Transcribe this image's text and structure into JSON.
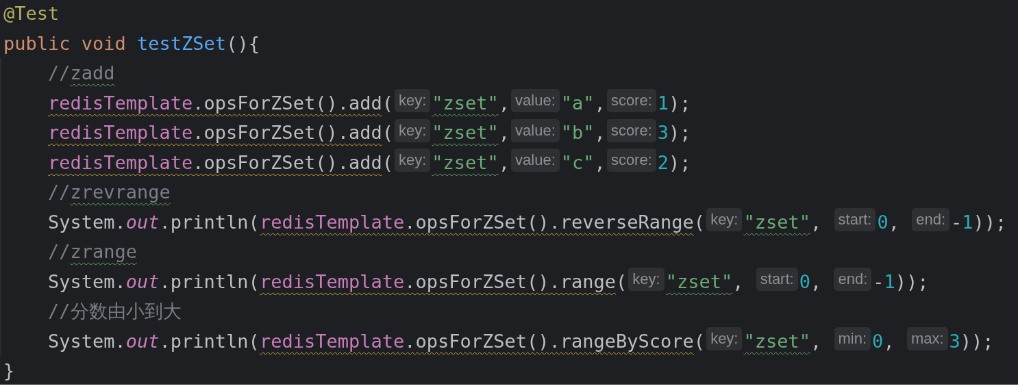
{
  "editor": {
    "lines": [
      {
        "indented": false,
        "tokens": [
          {
            "kind": "annotation",
            "text": "@Test",
            "warned": false,
            "misspelled": false
          }
        ]
      },
      {
        "indented": false,
        "tokens": [
          {
            "kind": "keyword",
            "text": "public void ",
            "warned": false,
            "misspelled": false
          },
          {
            "kind": "method",
            "text": "testZSet",
            "warned": false,
            "misspelled": false
          },
          {
            "kind": "plain",
            "text": "(){",
            "warned": false,
            "misspelled": false
          }
        ]
      },
      {
        "indented": true,
        "tokens": [
          {
            "kind": "comment",
            "text": "//",
            "warned": false,
            "misspelled": false
          },
          {
            "kind": "comment",
            "text": "zadd",
            "warned": false,
            "misspelled": true
          }
        ]
      },
      {
        "indented": true,
        "tokens": [
          {
            "kind": "field",
            "text": "redisTemplate",
            "warned": true,
            "misspelled": false
          },
          {
            "kind": "plain",
            "text": ".opsForZSet().add",
            "warned": true,
            "misspelled": false
          },
          {
            "kind": "plain",
            "text": "(",
            "warned": false,
            "misspelled": false
          },
          {
            "kind": "hint",
            "text": "key:",
            "warned": false,
            "misspelled": false
          },
          {
            "kind": "string",
            "text": "\"zset\"",
            "warned": false,
            "misspelled": true
          },
          {
            "kind": "plain",
            "text": ",",
            "warned": false,
            "misspelled": false
          },
          {
            "kind": "hint",
            "text": "value:",
            "warned": false,
            "misspelled": false
          },
          {
            "kind": "string",
            "text": "\"a\"",
            "warned": false,
            "misspelled": false
          },
          {
            "kind": "plain",
            "text": ",",
            "warned": false,
            "misspelled": false
          },
          {
            "kind": "hint",
            "text": "score:",
            "warned": false,
            "misspelled": false
          },
          {
            "kind": "number",
            "text": "1",
            "warned": false,
            "misspelled": false
          },
          {
            "kind": "plain",
            "text": ");",
            "warned": false,
            "misspelled": false
          }
        ]
      },
      {
        "indented": true,
        "tokens": [
          {
            "kind": "field",
            "text": "redisTemplate",
            "warned": true,
            "misspelled": false
          },
          {
            "kind": "plain",
            "text": ".opsForZSet().add",
            "warned": true,
            "misspelled": false
          },
          {
            "kind": "plain",
            "text": "(",
            "warned": false,
            "misspelled": false
          },
          {
            "kind": "hint",
            "text": "key:",
            "warned": false,
            "misspelled": false
          },
          {
            "kind": "string",
            "text": "\"zset\"",
            "warned": false,
            "misspelled": true
          },
          {
            "kind": "plain",
            "text": ",",
            "warned": false,
            "misspelled": false
          },
          {
            "kind": "hint",
            "text": "value:",
            "warned": false,
            "misspelled": false
          },
          {
            "kind": "string",
            "text": "\"b\"",
            "warned": false,
            "misspelled": false
          },
          {
            "kind": "plain",
            "text": ",",
            "warned": false,
            "misspelled": false
          },
          {
            "kind": "hint",
            "text": "score:",
            "warned": false,
            "misspelled": false
          },
          {
            "kind": "number",
            "text": "3",
            "warned": false,
            "misspelled": false
          },
          {
            "kind": "plain",
            "text": ");",
            "warned": false,
            "misspelled": false
          }
        ]
      },
      {
        "indented": true,
        "tokens": [
          {
            "kind": "field",
            "text": "redisTemplate",
            "warned": true,
            "misspelled": false
          },
          {
            "kind": "plain",
            "text": ".opsForZSet().add",
            "warned": true,
            "misspelled": false
          },
          {
            "kind": "plain",
            "text": "(",
            "warned": false,
            "misspelled": false
          },
          {
            "kind": "hint",
            "text": "key:",
            "warned": false,
            "misspelled": false
          },
          {
            "kind": "string",
            "text": "\"zset\"",
            "warned": false,
            "misspelled": true
          },
          {
            "kind": "plain",
            "text": ",",
            "warned": false,
            "misspelled": false
          },
          {
            "kind": "hint",
            "text": "value:",
            "warned": false,
            "misspelled": false
          },
          {
            "kind": "string",
            "text": "\"c\"",
            "warned": false,
            "misspelled": false
          },
          {
            "kind": "plain",
            "text": ",",
            "warned": false,
            "misspelled": false
          },
          {
            "kind": "hint",
            "text": "score:",
            "warned": false,
            "misspelled": false
          },
          {
            "kind": "number",
            "text": "2",
            "warned": false,
            "misspelled": false
          },
          {
            "kind": "plain",
            "text": ");",
            "warned": false,
            "misspelled": false
          }
        ]
      },
      {
        "indented": true,
        "tokens": [
          {
            "kind": "comment",
            "text": "//",
            "warned": false,
            "misspelled": false
          },
          {
            "kind": "comment",
            "text": "zrevrange",
            "warned": false,
            "misspelled": true
          }
        ]
      },
      {
        "indented": true,
        "tokens": [
          {
            "kind": "plain",
            "text": "System.",
            "warned": false,
            "misspelled": false
          },
          {
            "kind": "static",
            "text": "out",
            "warned": false,
            "misspelled": false
          },
          {
            "kind": "plain",
            "text": ".println(",
            "warned": false,
            "misspelled": false
          },
          {
            "kind": "field",
            "text": "redisTemplate",
            "warned": true,
            "misspelled": false
          },
          {
            "kind": "plain",
            "text": ".opsForZSet().reverseRange",
            "warned": true,
            "misspelled": false
          },
          {
            "kind": "plain",
            "text": "(",
            "warned": false,
            "misspelled": false
          },
          {
            "kind": "hint",
            "text": "key:",
            "warned": false,
            "misspelled": false
          },
          {
            "kind": "string",
            "text": "\"zset\"",
            "warned": false,
            "misspelled": true
          },
          {
            "kind": "plain",
            "text": ", ",
            "warned": false,
            "misspelled": false
          },
          {
            "kind": "hint",
            "text": "start:",
            "warned": false,
            "misspelled": false
          },
          {
            "kind": "number",
            "text": "0",
            "warned": false,
            "misspelled": false
          },
          {
            "kind": "plain",
            "text": ", ",
            "warned": false,
            "misspelled": false
          },
          {
            "kind": "hint",
            "text": "end:",
            "warned": false,
            "misspelled": false
          },
          {
            "kind": "plain",
            "text": "-",
            "warned": false,
            "misspelled": false
          },
          {
            "kind": "number",
            "text": "1",
            "warned": false,
            "misspelled": false
          },
          {
            "kind": "plain",
            "text": "));",
            "warned": false,
            "misspelled": false
          }
        ]
      },
      {
        "indented": true,
        "tokens": [
          {
            "kind": "comment",
            "text": "//",
            "warned": false,
            "misspelled": false
          },
          {
            "kind": "comment",
            "text": "zrange",
            "warned": false,
            "misspelled": true
          }
        ]
      },
      {
        "indented": true,
        "tokens": [
          {
            "kind": "plain",
            "text": "System.",
            "warned": false,
            "misspelled": false
          },
          {
            "kind": "static",
            "text": "out",
            "warned": false,
            "misspelled": false
          },
          {
            "kind": "plain",
            "text": ".println(",
            "warned": false,
            "misspelled": false
          },
          {
            "kind": "field",
            "text": "redisTemplate",
            "warned": true,
            "misspelled": false
          },
          {
            "kind": "plain",
            "text": ".opsForZSet().range",
            "warned": true,
            "misspelled": false
          },
          {
            "kind": "plain",
            "text": "(",
            "warned": false,
            "misspelled": false
          },
          {
            "kind": "hint",
            "text": "key:",
            "warned": false,
            "misspelled": false
          },
          {
            "kind": "string",
            "text": "\"zset\"",
            "warned": false,
            "misspelled": true
          },
          {
            "kind": "plain",
            "text": ", ",
            "warned": false,
            "misspelled": false
          },
          {
            "kind": "hint",
            "text": "start:",
            "warned": false,
            "misspelled": false
          },
          {
            "kind": "number",
            "text": "0",
            "warned": false,
            "misspelled": false
          },
          {
            "kind": "plain",
            "text": ", ",
            "warned": false,
            "misspelled": false
          },
          {
            "kind": "hint",
            "text": "end:",
            "warned": false,
            "misspelled": false
          },
          {
            "kind": "plain",
            "text": "-",
            "warned": false,
            "misspelled": false
          },
          {
            "kind": "number",
            "text": "1",
            "warned": false,
            "misspelled": false
          },
          {
            "kind": "plain",
            "text": "));",
            "warned": false,
            "misspelled": false
          }
        ]
      },
      {
        "indented": true,
        "tokens": [
          {
            "kind": "comment",
            "text": "//分数由小到大",
            "warned": false,
            "misspelled": false
          }
        ]
      },
      {
        "indented": true,
        "tokens": [
          {
            "kind": "plain",
            "text": "System.",
            "warned": false,
            "misspelled": false
          },
          {
            "kind": "static",
            "text": "out",
            "warned": false,
            "misspelled": false
          },
          {
            "kind": "plain",
            "text": ".println(",
            "warned": false,
            "misspelled": false
          },
          {
            "kind": "field",
            "text": "redisTemplate",
            "warned": true,
            "misspelled": false
          },
          {
            "kind": "plain",
            "text": ".opsForZSet().rangeByScore",
            "warned": true,
            "misspelled": false
          },
          {
            "kind": "plain",
            "text": "(",
            "warned": false,
            "misspelled": false
          },
          {
            "kind": "hint",
            "text": "key:",
            "warned": false,
            "misspelled": false
          },
          {
            "kind": "string",
            "text": "\"zset\"",
            "warned": false,
            "misspelled": true
          },
          {
            "kind": "plain",
            "text": ", ",
            "warned": false,
            "misspelled": false
          },
          {
            "kind": "hint",
            "text": "min:",
            "warned": false,
            "misspelled": false
          },
          {
            "kind": "number",
            "text": "0",
            "warned": false,
            "misspelled": false
          },
          {
            "kind": "plain",
            "text": ", ",
            "warned": false,
            "misspelled": false
          },
          {
            "kind": "hint",
            "text": "max:",
            "warned": false,
            "misspelled": false
          },
          {
            "kind": "number",
            "text": "3",
            "warned": false,
            "misspelled": false
          },
          {
            "kind": "plain",
            "text": "));",
            "warned": false,
            "misspelled": false
          }
        ]
      },
      {
        "indented": false,
        "tokens": [
          {
            "kind": "plain",
            "text": "}",
            "warned": false,
            "misspelled": false
          }
        ]
      }
    ]
  }
}
